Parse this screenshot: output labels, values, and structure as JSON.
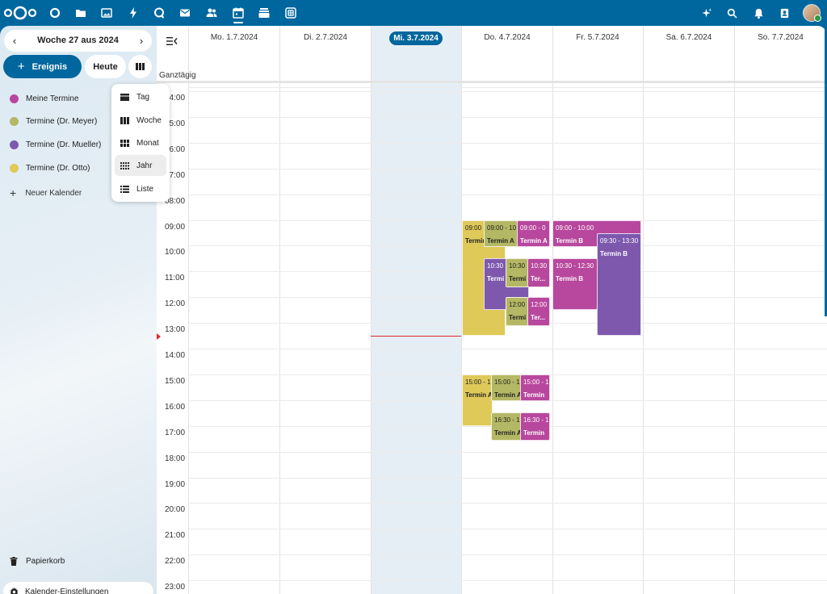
{
  "sidebar": {
    "week_label": "Woche 27 aus 2024",
    "prev_icon": "chevron-left-icon",
    "next_icon": "chevron-right-icon",
    "new_event_label": "Ereignis",
    "today_label": "Heute",
    "view_icon": "week-view-icon",
    "calendars": [
      {
        "label": "Meine Termine",
        "color": "#b8479e"
      },
      {
        "label": "Termine (Dr. Meyer)",
        "color": "#b4b864"
      },
      {
        "label": "Termine (Dr. Mueller)",
        "color": "#7d58ad"
      },
      {
        "label": "Termine (Dr. Otto)",
        "color": "#dfc959"
      }
    ],
    "new_calendar_label": "Neuer Kalender",
    "trash_label": "Papierkorb",
    "settings_label": "Kalender-Einstellungen"
  },
  "view_menu": {
    "items": [
      {
        "label": "Tag"
      },
      {
        "label": "Woche"
      },
      {
        "label": "Monat"
      },
      {
        "label": "Jahr"
      },
      {
        "label": "Liste"
      }
    ]
  },
  "calendar": {
    "allday_label": "Ganztägig",
    "days": [
      "Mo. 1.7.2024",
      "Di. 2.7.2024",
      "Mi. 3.7.2024",
      "Do. 4.7.2024",
      "Fr. 5.7.2024",
      "Sa. 6.7.2024",
      "So. 7.7.2024"
    ],
    "times": [
      "04:00",
      "05:00",
      "06:00",
      "07:00",
      "08:00",
      "09:00",
      "10:00",
      "11:00",
      "12:00",
      "13:00",
      "14:00",
      "15:00",
      "16:00",
      "17:00",
      "18:00",
      "19:00",
      "20:00",
      "21:00",
      "22:00",
      "23:00"
    ],
    "events": [
      {
        "time": "09:00",
        "name": "Termin"
      },
      {
        "time": "09:00 - 10",
        "name": "Termin A"
      },
      {
        "time": "09:00 - 0",
        "name": "Termin A"
      },
      {
        "time": "10:30",
        "name": "Termi"
      },
      {
        "time": "10:30",
        "name": "Termi"
      },
      {
        "time": "10:30",
        "name": "Ter..."
      },
      {
        "time": "12:00",
        "name": "Termi"
      },
      {
        "time": "12:00",
        "name": "Ter..."
      },
      {
        "time": "15:00 - 1",
        "name": "Termin A"
      },
      {
        "time": "15:00 - 1",
        "name": "Termin A"
      },
      {
        "time": "15:00 - 1",
        "name": "Termin"
      },
      {
        "time": "16:30 - 1",
        "name": "Termin A"
      },
      {
        "time": "16:30 - 1",
        "name": "Termin"
      },
      {
        "time": "09:00 - 10:00",
        "name": "Termin B"
      },
      {
        "time": "09:30 - 13:30",
        "name": "Termin B"
      },
      {
        "time": "10:30 - 12:30",
        "name": "Termin B"
      }
    ]
  }
}
